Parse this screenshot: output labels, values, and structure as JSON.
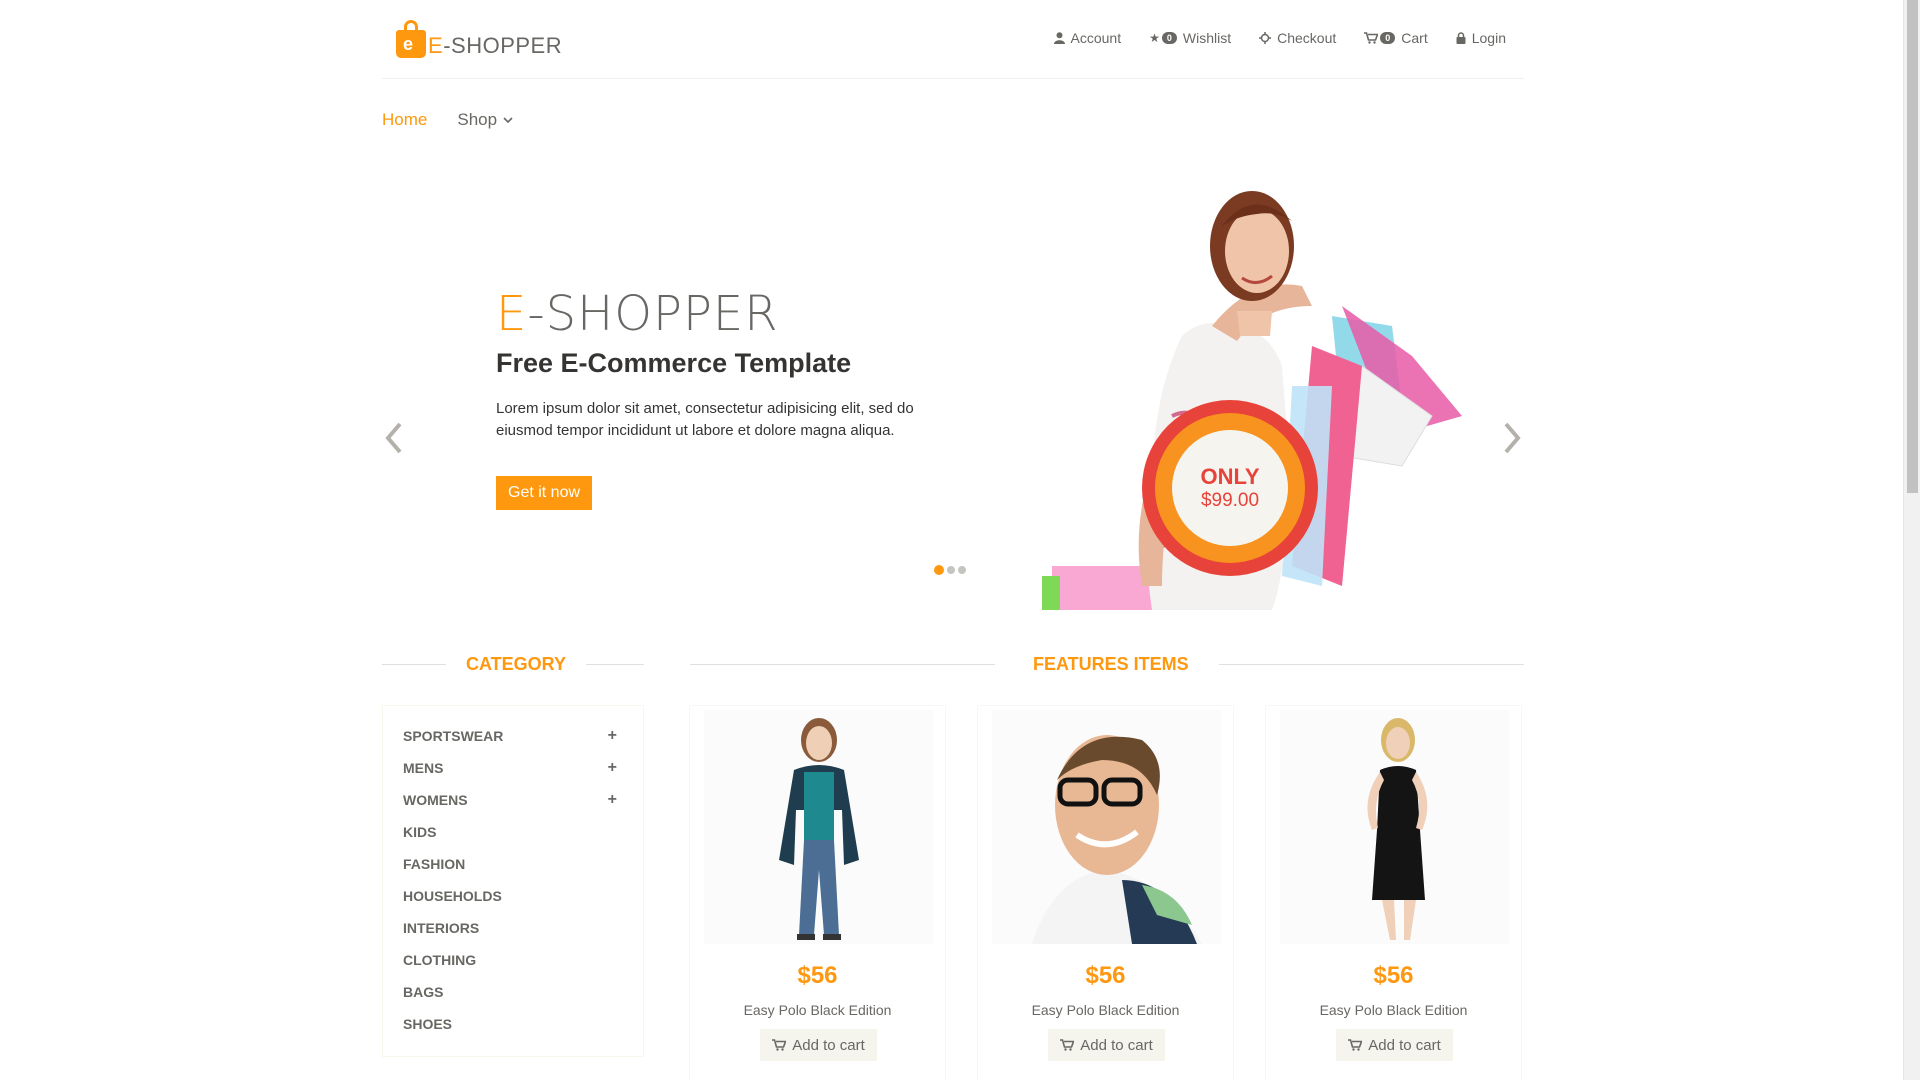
{
  "brand": {
    "prefix": "E",
    "name": "-SHOPPER",
    "accent": "#fe980f"
  },
  "header": {
    "menu": [
      {
        "icon": "user-icon",
        "label": "Account"
      },
      {
        "icon": "star-icon",
        "label": "Wishlist",
        "badge": "0"
      },
      {
        "icon": "crosshairs-icon",
        "label": "Checkout"
      },
      {
        "icon": "cart-icon",
        "label": "Cart",
        "badge": "0"
      },
      {
        "icon": "lock-icon",
        "label": "Login"
      }
    ]
  },
  "nav": {
    "home": "Home",
    "shop": "Shop"
  },
  "slider": {
    "title_prefix": "E",
    "title_rest": "-SHOPPER",
    "subtitle": "Free E-Commerce Template",
    "description": "Lorem ipsum dolor sit amet, consectetur adipisicing elit, sed do eiusmod tempor incididunt ut labore et dolore magna aliqua.",
    "button": "Get it now",
    "badge_top": "ONLY",
    "badge_price": "$99.00",
    "dots": 3,
    "active_dot": 1
  },
  "category": {
    "title": "CATEGORY",
    "items": [
      {
        "label": "SPORTSWEAR",
        "expand": "+"
      },
      {
        "label": "MENS",
        "expand": "+"
      },
      {
        "label": "WOMENS",
        "expand": "+"
      },
      {
        "label": "KIDS",
        "expand": ""
      },
      {
        "label": "FASHION",
        "expand": ""
      },
      {
        "label": "HOUSEHOLDS",
        "expand": ""
      },
      {
        "label": "INTERIORS",
        "expand": ""
      },
      {
        "label": "CLOTHING",
        "expand": ""
      },
      {
        "label": "BAGS",
        "expand": ""
      },
      {
        "label": "SHOES",
        "expand": ""
      }
    ]
  },
  "features": {
    "title": "FEATURES ITEMS",
    "products": [
      {
        "price": "$56",
        "name": "Easy Polo Black Edition",
        "button": "Add to cart"
      },
      {
        "price": "$56",
        "name": "Easy Polo Black Edition",
        "button": "Add to cart"
      },
      {
        "price": "$56",
        "name": "Easy Polo Black Edition",
        "button": "Add to cart"
      }
    ]
  }
}
